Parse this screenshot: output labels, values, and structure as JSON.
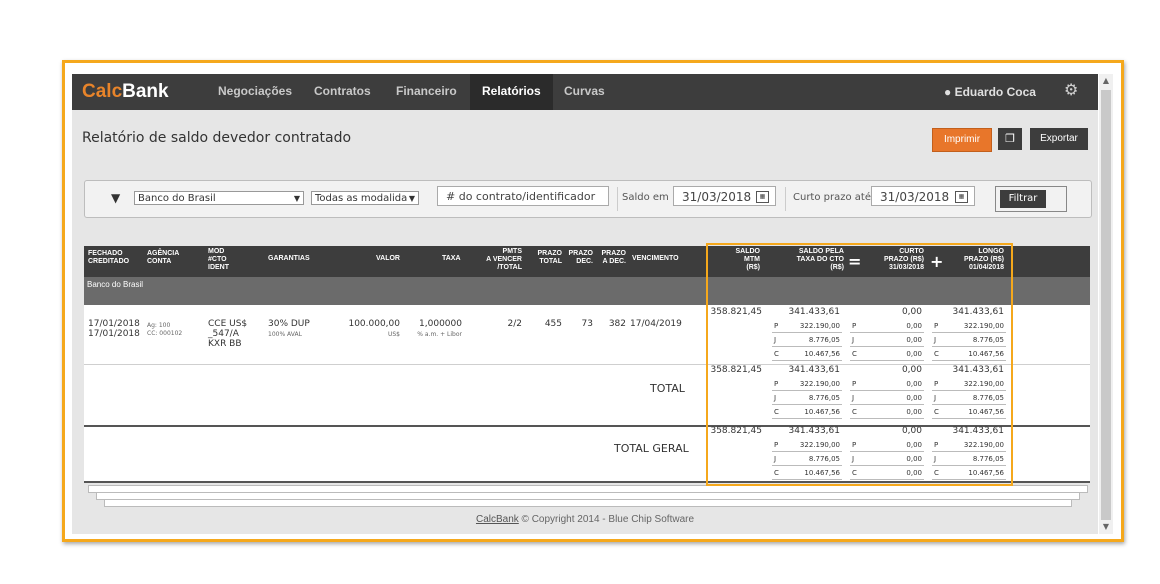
{
  "app": {
    "logo_calc": "Calc",
    "logo_bank": "Bank",
    "nav": [
      "Negociações",
      "Contratos",
      "Financeiro",
      "Relatórios",
      "Curvas"
    ],
    "active_nav": "Relatórios",
    "user": "Eduardo Coca",
    "icons": {
      "user": "user-icon",
      "settings": "gear-icon",
      "filter": "funnel-icon",
      "calendar": "calendar-icon",
      "copy": "copy-icon"
    }
  },
  "page": {
    "title": "Relatório de saldo devedor contratado",
    "print_label": "Imprimir",
    "export_label": "Exportar"
  },
  "filters": {
    "bank": "Banco do Brasil",
    "modality": "Todas as modalida",
    "contract_placeholder": "# do contrato/identificador",
    "saldo_label": "Saldo em",
    "saldo_date": "31/03/2018",
    "curto_label": "Curto prazo até",
    "curto_date": "31/03/2018",
    "filter_label": "Filtrar"
  },
  "table": {
    "headers": {
      "fechado": "FECHADO\nCREDITADO",
      "agencia": "AGÊNCIA\nCONTA",
      "mod": "MOD\n#CTO\nIDENT",
      "garantias": "GARANTIAS",
      "valor": "VALOR",
      "taxa": "TAXA",
      "pmts": "PMTS\nA VENCER\n/TOTAL",
      "prazo_total": "PRAZO\nTOTAL",
      "prazo_dec": "PRAZO\nDEC.",
      "prazo_adec": "PRAZO\nA DEC.",
      "vencimento": "VENCIMENTO",
      "saldo_mtm": "SALDO\nMTM\n(R$)",
      "saldo_taxa": "SALDO PELA\nTAXA DO CTO\n(R$)",
      "curto": "CURTO\nPRAZO (R$)\n31/03/2018",
      "longo": "LONGO\nPRAZO (R$)\n01/04/2018"
    },
    "group": "Banco do Brasil",
    "row": {
      "date1": "17/01/2018",
      "date2": "17/01/2018",
      "ag": "Ag: 100",
      "cc": "CC: 000102",
      "mod1": "CCE US$",
      "mod2": "_547/A",
      "mod3": "KXR BB",
      "gar1": "30% DUP",
      "gar2": "100% AVAL",
      "valor": "100.000,00",
      "valor_cur": "US$",
      "taxa": "1,000000",
      "taxa_sub": "% a.m. + Libor",
      "pmts": "2/2",
      "prazo_total": "455",
      "prazo_dec": "73",
      "prazo_adec": "382",
      "vencimento": "17/04/2019"
    },
    "total_label": "TOTAL",
    "total_geral_label": "TOTAL GERAL",
    "money": {
      "mtm": "358.821,45",
      "taxa_main": "341.433,61",
      "curto_main": "0,00",
      "longo_main": "341.433,61",
      "p_label": "P",
      "j_label": "J",
      "c_label": "C",
      "p": "322.190,00",
      "j": "8.776,05",
      "c": "10.467,56",
      "zero": "0,00"
    }
  },
  "footer": {
    "link": "CalcBank",
    "text": " © Copyright 2014 - Blue Chip Software"
  }
}
